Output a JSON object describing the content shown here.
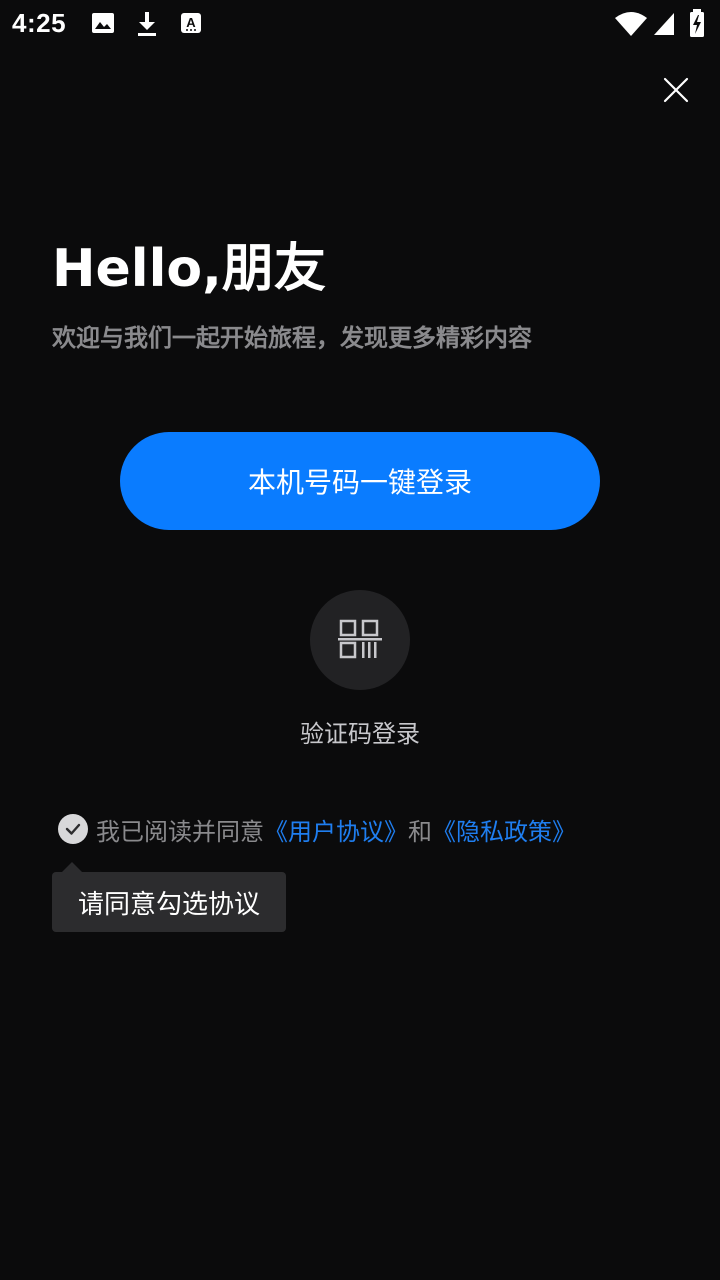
{
  "status_bar": {
    "time": "4:25",
    "notification_icons": [
      "image-icon",
      "download-icon",
      "font-app-icon"
    ],
    "system_icons": [
      "wifi-icon",
      "signal-icon",
      "battery-charging-icon"
    ]
  },
  "header": {
    "title": "Hello,朋友",
    "subtitle": "欢迎与我们一起开始旅程，发现更多精彩内容"
  },
  "login": {
    "one_click_label": "本机号码一键登录",
    "code_login_icon": "qr-code-icon",
    "code_login_label": "验证码登录"
  },
  "agreement": {
    "prefix": "我已阅读并同意",
    "user_agreement": "《用户协议》",
    "conjunction": "和",
    "privacy_policy": "《隐私政策》",
    "checked": false
  },
  "tooltip": {
    "text": "请同意勾选协议"
  },
  "colors": {
    "background": "#0b0b0c",
    "accent": "#0a7cff",
    "link": "#1f7ef0",
    "muted_text": "#8a8a8d"
  }
}
